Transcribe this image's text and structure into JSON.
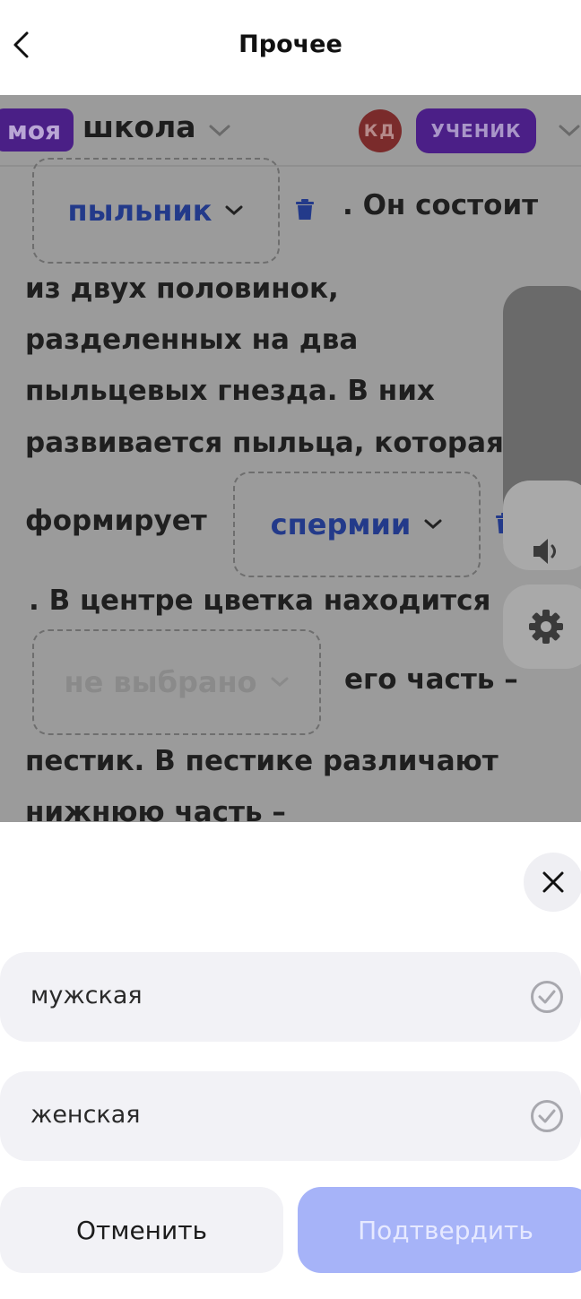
{
  "topbar": {
    "title": "Прочее"
  },
  "header": {
    "badge": "моя",
    "school": "школа",
    "avatar_initials": "КД",
    "role": "УЧЕНИК"
  },
  "text": {
    "line1_after": ". Он состоит",
    "line2": "из двух половинок,",
    "line3": "разделенных на два",
    "line4": "пыльцевых гнезда. В них",
    "line5": "развивается пыльца, которая",
    "line6_before": "формирует",
    "line7": ".  В центре цветка находится",
    "line8_after": "его часть –",
    "line9": "пестик. В пестике различают",
    "line10": "нижнюю часть –"
  },
  "dropdowns": {
    "d1": "пыльник",
    "d2": "спермии",
    "d3": "не выбрано"
  },
  "sheet": {
    "options": [
      {
        "label": "мужская"
      },
      {
        "label": "женская"
      }
    ],
    "cancel": "Отменить",
    "confirm": "Подтвердить"
  },
  "colors": {
    "accent_purple": "#4b1f87",
    "confirm_bg": "#a6b3f8",
    "option_bg": "#f2f2f6"
  },
  "icons": [
    "chevron-left-icon",
    "chevron-down-icon",
    "trash-icon",
    "speaker-icon",
    "gear-icon",
    "close-icon",
    "check-circle-icon"
  ]
}
